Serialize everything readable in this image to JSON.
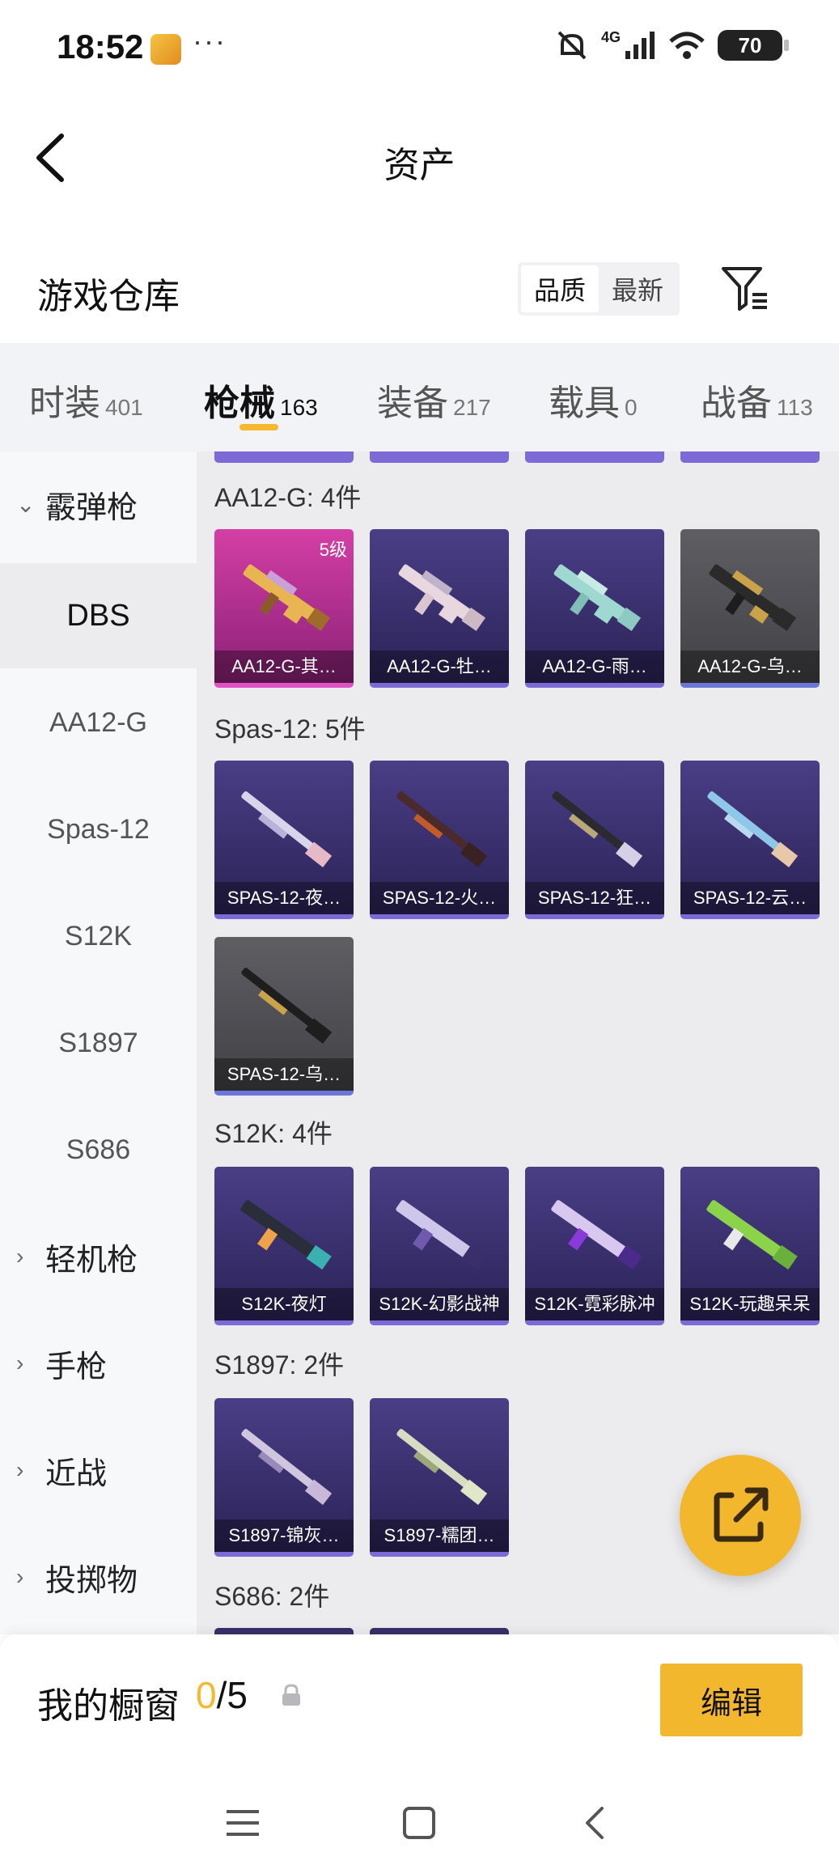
{
  "status_bar": {
    "time": "18:52",
    "dots": "···",
    "network": "4G",
    "battery": "70"
  },
  "header": {
    "title": "资产"
  },
  "repo": {
    "title": "游戏仓库",
    "sort_quality": "品质",
    "sort_newest": "最新"
  },
  "tabs": [
    {
      "label": "时装",
      "count": "401"
    },
    {
      "label": "枪械",
      "count": "163"
    },
    {
      "label": "装备",
      "count": "217"
    },
    {
      "label": "载具",
      "count": "0"
    },
    {
      "label": "战备",
      "count": "113"
    }
  ],
  "sidebar": {
    "groups": [
      {
        "label": "霰弹枪",
        "chev": "⌄"
      },
      {
        "label": "轻机枪",
        "chev": "›"
      },
      {
        "label": "手枪",
        "chev": "›"
      },
      {
        "label": "近战",
        "chev": "›"
      },
      {
        "label": "投掷物",
        "chev": "›"
      }
    ],
    "items": [
      "DBS",
      "AA12-G",
      "Spas-12",
      "S12K",
      "S1897",
      "S686"
    ]
  },
  "sections": [
    {
      "title": "AA12-G: 4件",
      "cards": [
        {
          "label": "AA12-G-其…",
          "level": "5级",
          "style": "pink"
        },
        {
          "label": "AA12-G-牡…",
          "style": "purple"
        },
        {
          "label": "AA12-G-雨…",
          "style": "purple"
        },
        {
          "label": "AA12-G-乌…",
          "style": "gray"
        }
      ]
    },
    {
      "title": "Spas-12: 5件",
      "cards": [
        {
          "label": "SPAS-12-夜…",
          "style": "purple"
        },
        {
          "label": "SPAS-12-火…",
          "style": "purple"
        },
        {
          "label": "SPAS-12-狂…",
          "style": "purple"
        },
        {
          "label": "SPAS-12-云…",
          "style": "purple"
        },
        {
          "label": "SPAS-12-乌…",
          "style": "gray"
        }
      ]
    },
    {
      "title": "S12K: 4件",
      "cards": [
        {
          "label": "S12K-夜灯",
          "style": "purple"
        },
        {
          "label": "S12K-幻影战神",
          "style": "purple"
        },
        {
          "label": "S12K-霓彩脉冲",
          "style": "purple"
        },
        {
          "label": "S12K-玩趣呆呆",
          "style": "purple"
        }
      ]
    },
    {
      "title": "S1897: 2件",
      "cards": [
        {
          "label": "S1897-锦灰…",
          "style": "purple"
        },
        {
          "label": "S1897-糯团…",
          "style": "purple"
        }
      ]
    },
    {
      "title": "S686: 2件",
      "cards": []
    }
  ],
  "showcase": {
    "title": "我的橱窗",
    "current": "0",
    "total": "/5",
    "edit_label": "编辑"
  },
  "colors": {
    "accent": "#f3b72e",
    "rarity_purple": "#7e6ad6",
    "rarity_pink": "#e052c3"
  }
}
